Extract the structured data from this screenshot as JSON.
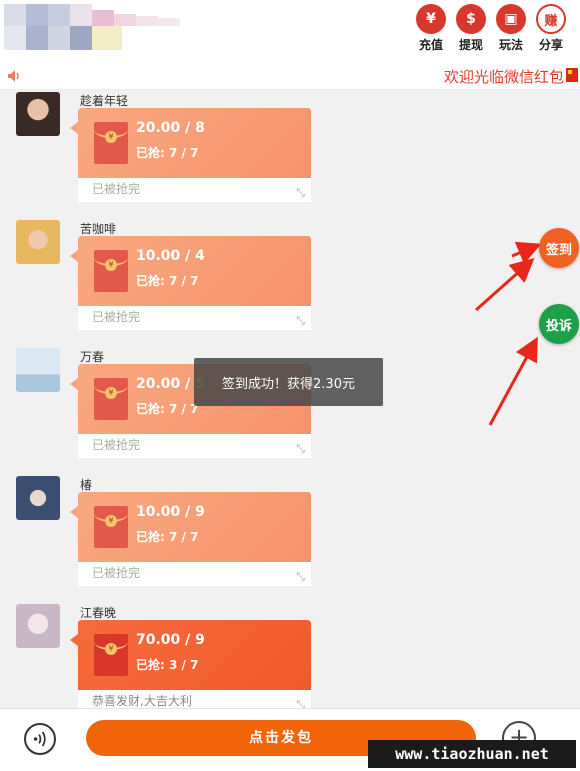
{
  "header": {
    "buttons": [
      {
        "label": "充值",
        "glyph": "¥",
        "icon": "yen-icon"
      },
      {
        "label": "提现",
        "glyph": "$",
        "icon": "withdraw-icon"
      },
      {
        "label": "玩法",
        "glyph": "▣",
        "icon": "gift-icon"
      },
      {
        "label": "分享",
        "glyph": "赚",
        "icon": "earn-share-icon"
      }
    ]
  },
  "marquee": {
    "text": "欢迎光临微信红包",
    "speaker_icon": "speaker-icon",
    "flag_icon": "china-flag-icon"
  },
  "messages": [
    {
      "user": "趁着年轻",
      "amount": "20.00 / 8",
      "grabbed": "已抢: 7 / 7",
      "status": "已被抢完"
    },
    {
      "user": "苦咖啡",
      "amount": "10.00 / 4",
      "grabbed": "已抢: 7 / 7",
      "status": "已被抢完"
    },
    {
      "user": "万春",
      "amount": "20.00 / 5",
      "grabbed": "已抢: 7 / 7",
      "status": "已被抢完"
    },
    {
      "user": "椿",
      "amount": "10.00 / 9",
      "grabbed": "已抢: 7 / 7",
      "status": "已被抢完"
    },
    {
      "user": "江春晚",
      "amount": "70.00 / 9",
      "grabbed": "已抢: 3 / 7",
      "status": "恭喜发财,大吉大利"
    }
  ],
  "side": {
    "checkin": "签到",
    "complain": "投诉"
  },
  "toast": "签到成功！获得2.30元",
  "bottom": {
    "send_label": "点击发包",
    "plus": "+",
    "voice_icon": "voice-icon"
  },
  "watermark": "www.tiaozhuan.net",
  "colors": {
    "accent": "#f0640a",
    "red": "#d8372b",
    "green": "#1ea048",
    "card": "#f8a981"
  }
}
